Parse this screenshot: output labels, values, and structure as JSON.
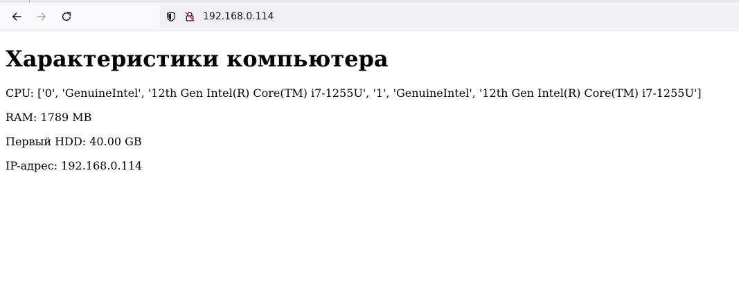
{
  "browser": {
    "url": "192.168.0.114",
    "icons": {
      "back": "arrow-left-icon",
      "forward": "arrow-right-icon",
      "reload": "reload-icon",
      "tracking_protection": "shield-icon",
      "insecure": "insecure-lock-icon"
    },
    "forward_enabled": false
  },
  "page": {
    "title": "Характеристики компьютера",
    "cpu": "CPU: ['0', 'GenuineIntel', '12th Gen Intel(R) Core(TM) i7-1255U', '1', 'GenuineIntel', '12th Gen Intel(R) Core(TM) i7-1255U']",
    "ram": "RAM: 1789 MB",
    "hdd": "Первый HDD: 40.00 GB",
    "ip": "IP-адрес: 192.168.0.114"
  },
  "colors": {
    "toolbar_bg": "#f9f9fb",
    "urlbar_bg": "#f0f0f4",
    "insecure_red": "#e22850"
  }
}
